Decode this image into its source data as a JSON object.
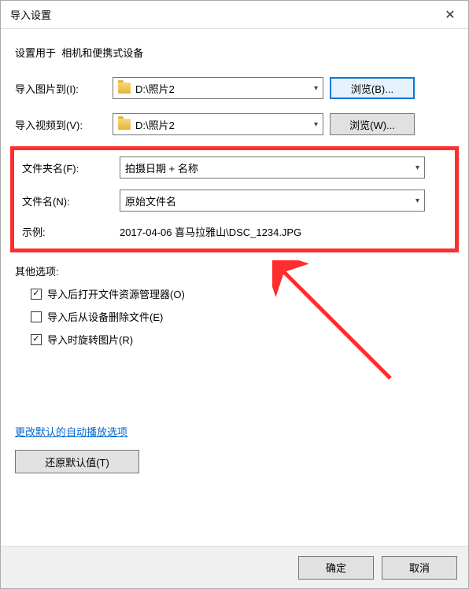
{
  "title": "导入设置",
  "heading_prefix": "设置用于",
  "heading_device": "相机和便携式设备",
  "rows": {
    "import_images": {
      "label": "导入图片到(I):",
      "value": "D:\\照片2",
      "browse": "浏览(B)..."
    },
    "import_videos": {
      "label": "导入视频到(V):",
      "value": "D:\\照片2",
      "browse": "浏览(W)..."
    },
    "folder_name": {
      "label": "文件夹名(F):",
      "value": "拍摄日期 + 名称"
    },
    "file_name": {
      "label": "文件名(N):",
      "value": "原始文件名"
    },
    "example": {
      "label": "示例:",
      "value": "2017-04-06 喜马拉雅山\\DSC_1234.JPG"
    }
  },
  "other_options_label": "其他选项:",
  "checkboxes": [
    {
      "label": "导入后打开文件资源管理器(O)",
      "checked": true
    },
    {
      "label": "导入后从设备删除文件(E)",
      "checked": false
    },
    {
      "label": "导入时旋转图片(R)",
      "checked": true
    }
  ],
  "link": "更改默认的自动播放选项",
  "restore_defaults": "还原默认值(T)",
  "ok": "确定",
  "cancel": "取消"
}
